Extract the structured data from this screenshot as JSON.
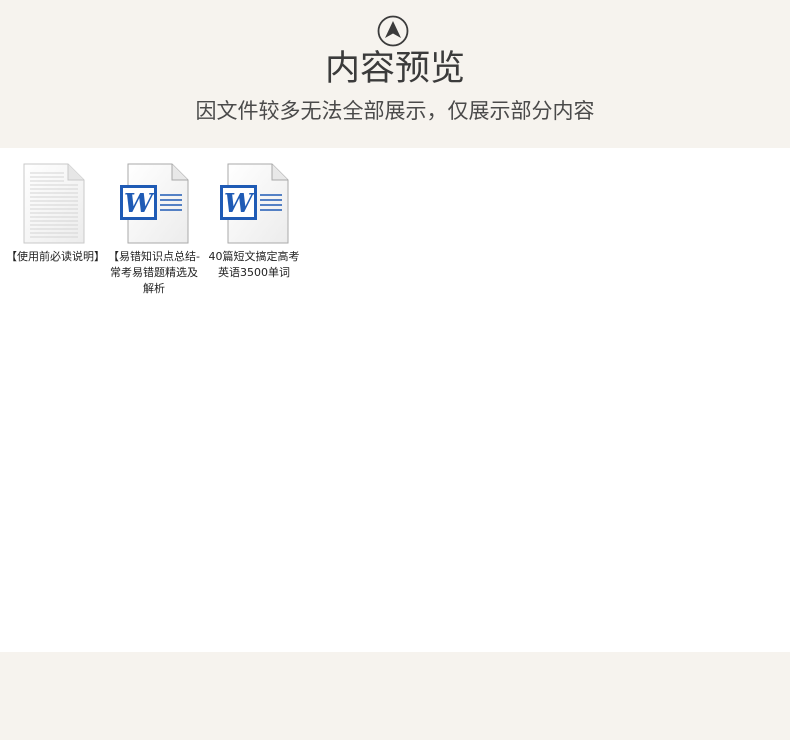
{
  "header": {
    "icon": "chevron-up-circle-icon",
    "title": "内容预览",
    "subtitle": "因文件较多无法全部展示，仅展示部分内容"
  },
  "files": [
    {
      "name": "【使用前必读说明】",
      "icon": "text-document-icon"
    },
    {
      "name": "【易错知识点总结-常考易错题精选及解析",
      "icon": "word-document-icon"
    },
    {
      "name": "40篇短文搞定高考英语3500单词",
      "icon": "word-document-icon"
    }
  ],
  "colors": {
    "background_band": "#f6f3ee",
    "word_blue": "#1f5bb5"
  }
}
